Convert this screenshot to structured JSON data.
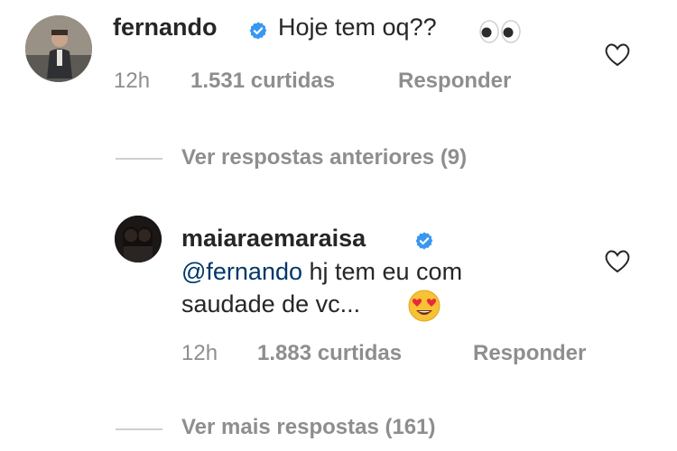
{
  "comments": [
    {
      "username": "fernando",
      "verified": true,
      "text": "Hoje tem oq??",
      "trailing_emoji": "eyes-emoji",
      "time": "12h",
      "likes": "1.531 curtidas",
      "reply_label": "Responder"
    },
    {
      "username": "maiaraemaraisa",
      "verified": true,
      "mention": "@fernando",
      "text_line1_rest": " hj tem eu com",
      "text_line2": "saudade de vc...",
      "trailing_emoji": "heart-eyes-emoji",
      "time": "12h",
      "likes": "1.883 curtidas",
      "reply_label": "Responder"
    }
  ],
  "view_previous_replies": "Ver respostas anteriores (9)",
  "view_more_replies": "Ver mais respostas (161)",
  "colors": {
    "text": "#262626",
    "secondary": "#8e8e8e",
    "mention": "#00376b",
    "verified_blue": "#3897f0",
    "divider": "#cfcfcf"
  }
}
